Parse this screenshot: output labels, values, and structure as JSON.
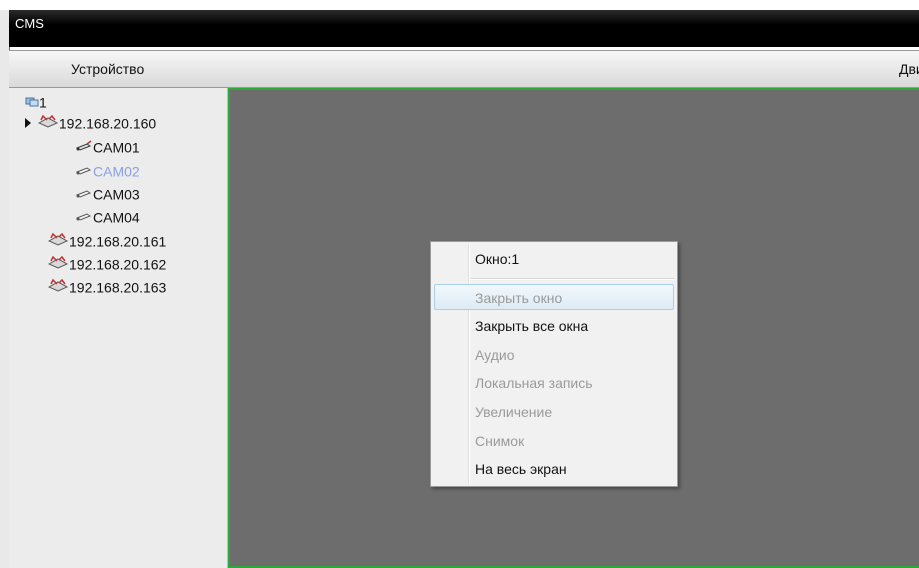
{
  "app": {
    "title": "CMS"
  },
  "header": {
    "device_col": "Устройство",
    "col2": "Дви"
  },
  "tree": {
    "root": {
      "label": "1",
      "icon": "group-icon"
    },
    "devices": [
      {
        "label": "192.168.20.160",
        "icon": "dvr-icon",
        "expanded": true,
        "cameras": [
          {
            "label": "CAM01",
            "icon": "camera-icon",
            "active": true
          },
          {
            "label": "CAM02",
            "icon": "camera-icon",
            "selected": true
          },
          {
            "label": "CAM03",
            "icon": "camera-icon"
          },
          {
            "label": "CAM04",
            "icon": "camera-icon"
          }
        ]
      },
      {
        "label": "192.168.20.161",
        "icon": "dvr-icon"
      },
      {
        "label": "192.168.20.162",
        "icon": "dvr-icon"
      },
      {
        "label": "192.168.20.163",
        "icon": "dvr-icon"
      }
    ]
  },
  "context_menu": {
    "title": "Окно:1",
    "items": [
      {
        "label": "Закрыть окно",
        "enabled": false,
        "hover": true
      },
      {
        "label": "Закрыть все окна",
        "enabled": true
      },
      {
        "label": "Аудио",
        "enabled": false
      },
      {
        "label": "Локальная запись",
        "enabled": false
      },
      {
        "label": "Увеличение",
        "enabled": false
      },
      {
        "label": "Снимок",
        "enabled": false
      },
      {
        "label": "На весь экран",
        "enabled": true
      }
    ]
  },
  "colors": {
    "video_bg": "#6d6d6d",
    "video_border": "#2fa83a",
    "selected_text": "#8aa0e6"
  }
}
